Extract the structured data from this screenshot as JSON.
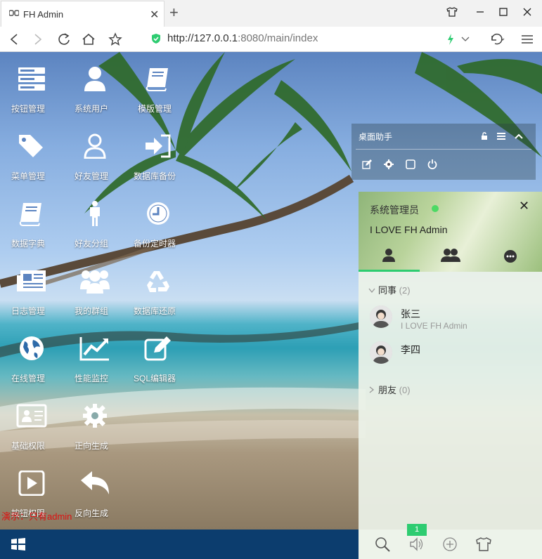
{
  "browser": {
    "tab_title": "FH Admin",
    "url_host": "http://127.0.0.1",
    "url_path": ":8080/main/index"
  },
  "desktop_icons": [
    {
      "label": "按钮管理",
      "icon": "server-icon"
    },
    {
      "label": "系统用户",
      "icon": "user-icon"
    },
    {
      "label": "模版管理",
      "icon": "book-icon"
    },
    {
      "label": "菜单管理",
      "icon": "tags-icon"
    },
    {
      "label": "好友管理",
      "icon": "user-outline-icon"
    },
    {
      "label": "数据库备份",
      "icon": "sign-in-icon"
    },
    {
      "label": "数据字典",
      "icon": "book-icon"
    },
    {
      "label": "好友分组",
      "icon": "male-icon"
    },
    {
      "label": "备份定时器",
      "icon": "clock-icon"
    },
    {
      "label": "日志管理",
      "icon": "newspaper-icon"
    },
    {
      "label": "我的群组",
      "icon": "group-icon"
    },
    {
      "label": "数据库还原",
      "icon": "recycle-icon"
    },
    {
      "label": "在线管理",
      "icon": "globe-icon"
    },
    {
      "label": "性能监控",
      "icon": "line-chart-icon"
    },
    {
      "label": "SQL编辑器",
      "icon": "edit-icon"
    },
    {
      "label": "基础权限",
      "icon": "id-card-icon"
    },
    {
      "label": "正向生成",
      "icon": "cog-icon"
    },
    {
      "label": "按钮权限",
      "icon": "play-square-icon"
    },
    {
      "label": "反向生成",
      "icon": "reply-icon"
    }
  ],
  "watermark": "演示：只有admin",
  "desk_helper": {
    "title": "桌面助手"
  },
  "chat": {
    "user_name": "系统管理员",
    "signature": "I LOVE FH Admin",
    "groups": [
      {
        "name": "同事",
        "count": "(2)",
        "expanded": true,
        "members": [
          {
            "name": "张三",
            "signature": "I LOVE FH Admin"
          },
          {
            "name": "李四",
            "signature": ""
          }
        ]
      },
      {
        "name": "朋友",
        "count": "(0)",
        "expanded": false,
        "members": []
      }
    ],
    "badge": "1"
  },
  "colors": {
    "accent": "#2ecc71",
    "taskbar": "#0c3d6e",
    "watermark": "#dd1111"
  }
}
